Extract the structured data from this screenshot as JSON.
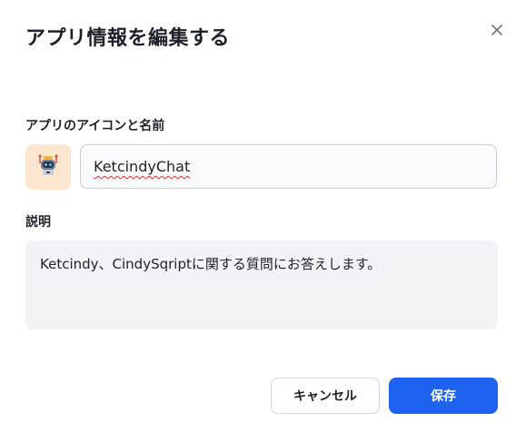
{
  "dialog": {
    "title": "アプリ情報を編集する",
    "close_icon": "close-icon"
  },
  "app": {
    "icon_label": "アプリのアイコンと名前",
    "icon": "robot-icon",
    "icon_bg_color": "#fde6cf",
    "name_value": "KetcindyChat"
  },
  "description": {
    "label": "説明",
    "value": "Ketcindy、CindySqriptに関する質問にお答えします。"
  },
  "actions": {
    "cancel_label": "キャンセル",
    "save_label": "保存",
    "save_color": "#1e63ef"
  }
}
